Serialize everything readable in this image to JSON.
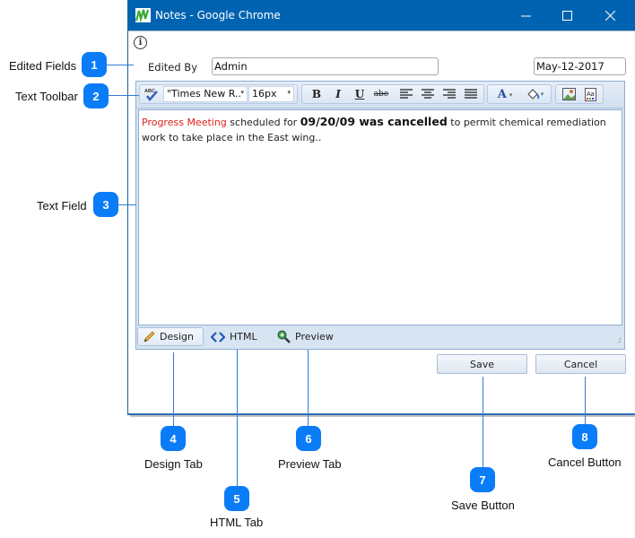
{
  "window": {
    "title": "Notes - Google Chrome",
    "controls": {
      "minimize": "—",
      "maximize": "☐",
      "close": "✕"
    },
    "info_icon": "i"
  },
  "fields": {
    "edited_by_label": "Edited By",
    "edited_by_value": "Admin",
    "date_value": "May-12-2017"
  },
  "toolbar": {
    "spellcheck_icon": "ABC",
    "font_family": "\"Times New R..",
    "font_size": "16px",
    "bold": "B",
    "italic": "I",
    "underline": "U",
    "strikethrough": "abe",
    "font_color": "A",
    "dropdown_arrow": "▾"
  },
  "content": {
    "segment_red": "Progress Meeting",
    "segment_1": " scheduled for ",
    "segment_bold": "09/20/09 was cancelled",
    "segment_2": " to permit chemical remediation work to take place in the East wing..",
    "red_color": "#e0201b"
  },
  "tabs": [
    {
      "label": "Design",
      "icon": "pencil-icon",
      "active": true
    },
    {
      "label": "HTML",
      "icon": "code-icon",
      "active": false
    },
    {
      "label": "Preview",
      "icon": "magnifier-icon",
      "active": false
    }
  ],
  "buttons": {
    "save": "Save",
    "cancel": "Cancel"
  },
  "callouts": [
    {
      "number": "1",
      "label": "Edited Fields"
    },
    {
      "number": "2",
      "label": "Text Toolbar"
    },
    {
      "number": "3",
      "label": "Text Field"
    },
    {
      "number": "4",
      "label": "Design Tab"
    },
    {
      "number": "5",
      "label": "HTML Tab"
    },
    {
      "number": "6",
      "label": "Preview Tab"
    },
    {
      "number": "7",
      "label": "Save Button"
    },
    {
      "number": "8",
      "label": "Cancel Button"
    }
  ],
  "colors": {
    "titlebar": "#0063b1",
    "badge": "#0a7cf8",
    "callout_line": "#2d7dd6"
  }
}
